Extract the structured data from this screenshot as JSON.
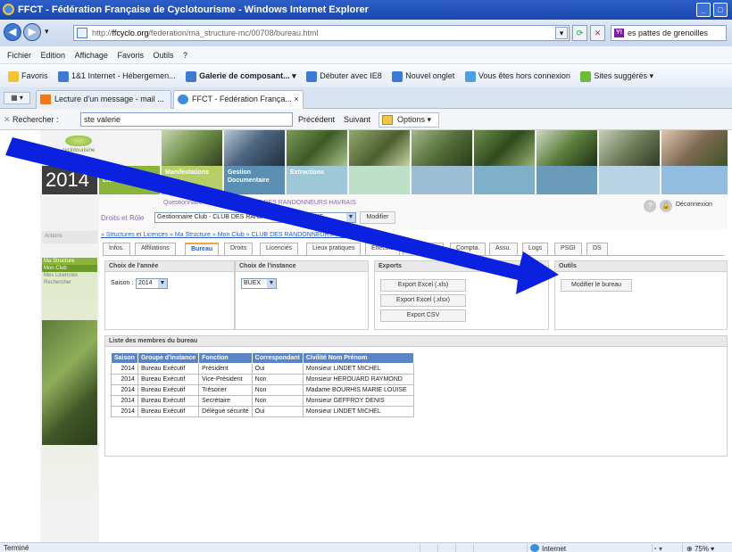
{
  "window": {
    "title": "FFCT - Fédération Française de Cyclotourisme - Windows Internet Explorer",
    "btn_min": "_",
    "btn_max": "□"
  },
  "address": {
    "prefix": "http://",
    "domain": "ffcyclo.org",
    "path": "/federation/ma_structure-mc/00708/bureau.html",
    "search_text": "es pattes de grenoilles"
  },
  "menu": [
    "Fichier",
    "Edition",
    "Affichage",
    "Favoris",
    "Outils",
    "?"
  ],
  "favorites": {
    "label": "Favoris",
    "items": [
      "1&1 Internet - Hébergemen...",
      "Galerie de composant... ▾",
      "Débuter avec IE8",
      "Nouvel onglet",
      "Vous êtes hors connexion",
      "Sites suggérés ▾"
    ]
  },
  "tabs": [
    "Lecture d'un message - mail ...",
    "FFCT - Fédération Françа... ×"
  ],
  "find": {
    "label": "Rechercher :",
    "value": "ste valerie",
    "prev": "Précédent",
    "next": "Suivant",
    "options": "Options ▾"
  },
  "site": {
    "year": "2014",
    "logo_text": "cyclotourisme",
    "nav": [
      "Structures et Licences",
      "Manifestations",
      "Gestion Documentaire",
      "Extractions"
    ],
    "header_line1": "Questionnaire Club - 00708 - CLUB DES RANDONNEURS HAVRAIS",
    "roles_label": "Droits et Rôle",
    "role_select": "Gestionnaire Club - CLUB DES RANDONNEURS HAVRAIS",
    "modify": "Modifier",
    "deconnexion": "Déconnexion",
    "breadcrumb": "» Structures et Licences » Ma Structure » Mon Club » CLUB DES RANDONNEURS HAVRAIS",
    "actions": "Actions",
    "sidebar_head": "Ma Structure",
    "sidebar_items": [
      "Mon Club",
      "Mes Licenciés",
      "Rechercher"
    ]
  },
  "content_tabs": [
    "Infos.",
    "Affiliations",
    "Bureau",
    "Droits",
    "Licenciés",
    "Lieux pratiques",
    "Effectifs",
    "Structures",
    "Compta.",
    "Assu.",
    "Logs",
    "PSGI",
    "DS"
  ],
  "panels": {
    "annee": {
      "title": "Choix de l'année",
      "label": "Saison :",
      "value": "2014"
    },
    "instance": {
      "title": "Choix de l'instance",
      "value": "BUEX"
    },
    "exports": {
      "title": "Exports",
      "buttons": [
        "Export Excel (.xls)",
        "Export Excel (.xlsx)",
        "Export CSV"
      ]
    },
    "outils": {
      "title": "Outils",
      "button": "Modifier le bureau"
    }
  },
  "members": {
    "title": "Liste des membres du bureau",
    "columns": [
      "Saison",
      "Groupe d'instance",
      "Fonction",
      "Correspondant",
      "Civilité Nom Prénom"
    ],
    "rows": [
      [
        "2014",
        "Bureau Exécutif",
        "Président",
        "Oui",
        "Monsieur LINDET MICHEL"
      ],
      [
        "2014",
        "Bureau Exécutif",
        "Vice-Président",
        "Non",
        "Monsieur HEROUARD RAYMOND"
      ],
      [
        "2014",
        "Bureau Exécutif",
        "Trésorier",
        "Non",
        "Madame BOURHIS MARIE LOUISE"
      ],
      [
        "2014",
        "Bureau Exécutif",
        "Secrétaire",
        "Non",
        "Monsieur GEFFROY DENIS"
      ],
      [
        "2014",
        "Bureau Exécutif",
        "Délégué sécurité",
        "Oui",
        "Monsieur LINDET MICHEL"
      ]
    ]
  },
  "status": {
    "left": "Terminé",
    "zone": "Internet",
    "zoom": "75%"
  },
  "colors": {
    "accent": "#2a5bbf",
    "nav_green": "#8bb53a",
    "arrow": "#0a22e0"
  }
}
